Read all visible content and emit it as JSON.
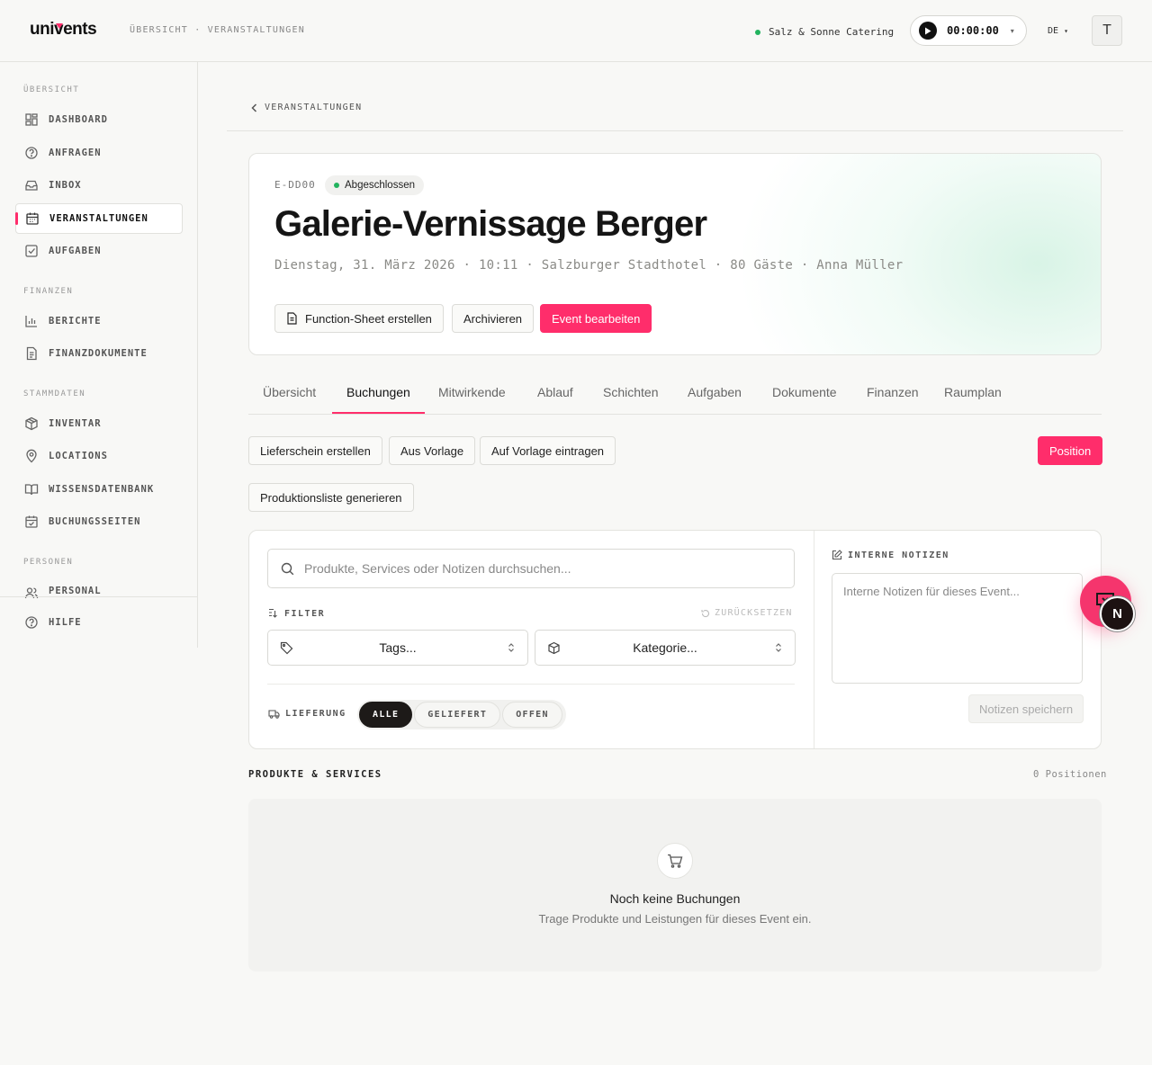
{
  "topbar": {
    "logo": "univents",
    "breadcrumb": "ÜBERSICHT · VERANSTALTUNGEN",
    "organization": "Salz & Sonne Catering",
    "timer": "00:00:00",
    "language": "DE",
    "avatar_initial": "T"
  },
  "sidebar": {
    "sections": {
      "overview": "ÜBERSICHT",
      "finance": "FINANZEN",
      "masterdata": "STAMMDATEN",
      "people": "PERSONEN"
    },
    "items": {
      "dashboard": "DASHBOARD",
      "requests": "ANFRAGEN",
      "inbox": "INBOX",
      "events": "VERANSTALTUNGEN",
      "tasks": "AUFGABEN",
      "reports": "BERICHTE",
      "findocs": "FINANZDOKUMENTE",
      "inventory": "INVENTAR",
      "locations": "LOCATIONS",
      "knowledge": "WISSENSDATENBANK",
      "booking_pages": "BUCHUNGSSEITEN",
      "staff": "PERSONAL",
      "help": "HILFE"
    },
    "active": "events"
  },
  "back_link": "VERANSTALTUNGEN",
  "event": {
    "code": "E-DD00",
    "status": "Abgeschlossen",
    "title": "Galerie-Vernissage Berger",
    "meta": "Dienstag, 31. März 2026 · 10:11 · Salzburger Stadthotel · 80 Gäste · Anna Müller",
    "buttons": {
      "function_sheet": "Function-Sheet erstellen",
      "archive": "Archivieren",
      "edit": "Event bearbeiten"
    }
  },
  "tabs": [
    "Übersicht",
    "Buchungen",
    "Mitwirkende",
    "Ablauf",
    "Schichten",
    "Aufgaben",
    "Dokumente",
    "Finanzen",
    "Raumplan"
  ],
  "active_tab": "Buchungen",
  "actions": {
    "delivery_note": "Lieferschein erstellen",
    "from_template": "Aus Vorlage",
    "to_template": "Auf Vorlage eintragen",
    "position": "Position",
    "production_list": "Produktionsliste generieren"
  },
  "filter": {
    "search_placeholder": "Produkte, Services oder Notizen durchsuchen...",
    "label": "FILTER",
    "reset": "ZURÜCKSETZEN",
    "tags_placeholder": "Tags...",
    "category_placeholder": "Kategorie...",
    "delivery_label": "LIEFERUNG",
    "delivery_options": [
      "ALLE",
      "GELIEFERT",
      "OFFEN"
    ],
    "delivery_selected": "ALLE"
  },
  "notes": {
    "label": "INTERNE NOTIZEN",
    "placeholder": "Interne Notizen für dieses Event...",
    "save": "Notizen speichern"
  },
  "products": {
    "label": "PRODUKTE & SERVICES",
    "count": "0 Positionen",
    "empty_title": "Noch keine Buchungen",
    "empty_subtitle": "Trage Produkte und Leistungen für dieses Event ein."
  },
  "fab_badge": "N",
  "colors": {
    "accent": "#ff2d6b",
    "status_green": "#22b35e",
    "dark": "#1d1a18"
  }
}
